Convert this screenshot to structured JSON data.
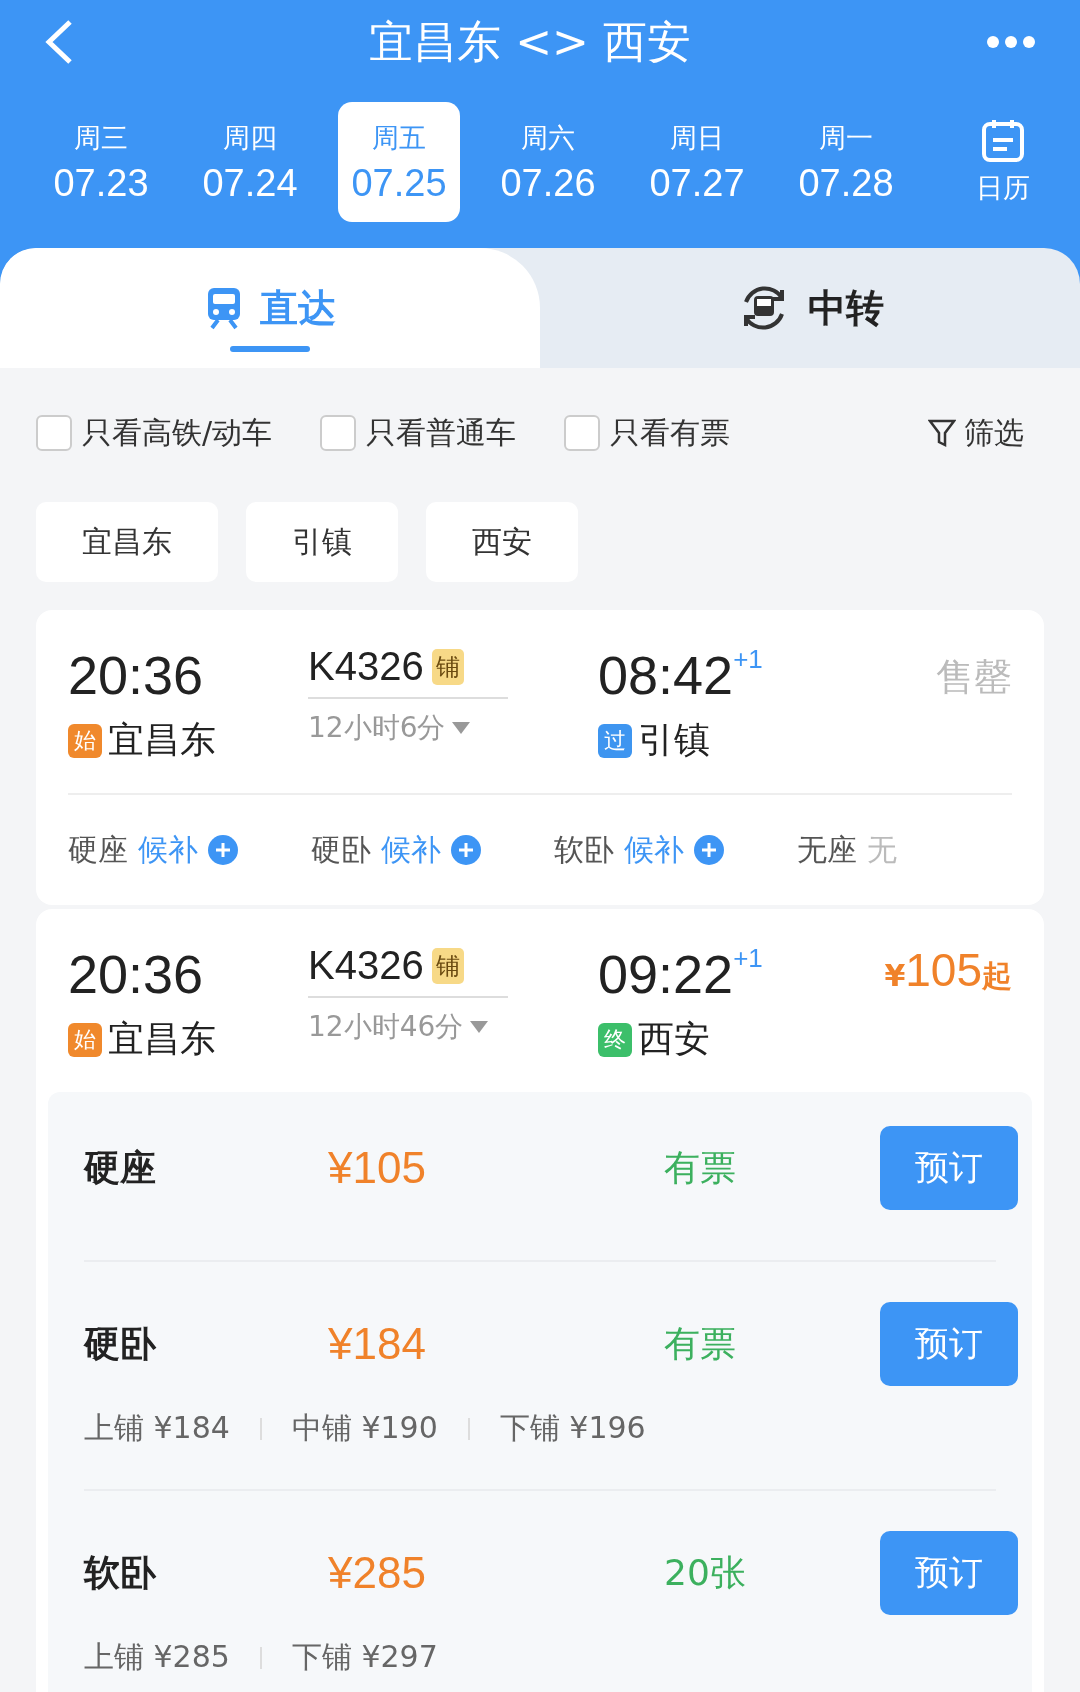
{
  "header": {
    "title": "宜昌东 <> 西安"
  },
  "dates": [
    {
      "weekday": "周三",
      "date": "07.23",
      "selected": false
    },
    {
      "weekday": "周四",
      "date": "07.24",
      "selected": false
    },
    {
      "weekday": "周五",
      "date": "07.25",
      "selected": true
    },
    {
      "weekday": "周六",
      "date": "07.26",
      "selected": false
    },
    {
      "weekday": "周日",
      "date": "07.27",
      "selected": false
    },
    {
      "weekday": "周一",
      "date": "07.28",
      "selected": false
    }
  ],
  "calendar": {
    "label": "日历"
  },
  "tabs": [
    {
      "label": "直达",
      "kind": "direct",
      "selected": true
    },
    {
      "label": "中转",
      "kind": "transfer",
      "selected": false
    }
  ],
  "filters": [
    {
      "label": "只看高铁/动车",
      "checked": false
    },
    {
      "label": "只看普通车",
      "checked": false
    },
    {
      "label": "只看有票",
      "checked": false
    }
  ],
  "filter_button": {
    "label": "筛选"
  },
  "stations": [
    "宜昌东",
    "引镇",
    "西安"
  ],
  "trains": [
    {
      "kind": "sold_out",
      "depart_time": "20:36",
      "depart_tag": {
        "label": "始",
        "color": "#f0892c"
      },
      "depart_station": "宜昌东",
      "number": "K4326",
      "badge": "铺",
      "duration": "12小时6分",
      "arrive_time": "08:42",
      "day_offset": "+1",
      "arrive_tag": {
        "label": "过",
        "color": "#3e95f0"
      },
      "arrive_station": "引镇",
      "status": "售罄",
      "seats": [
        {
          "seat": "硬座",
          "status": "候补",
          "waitlist": true
        },
        {
          "seat": "硬卧",
          "status": "候补",
          "waitlist": true
        },
        {
          "seat": "软卧",
          "status": "候补",
          "waitlist": true
        },
        {
          "seat": "无座",
          "status": "无",
          "waitlist": false
        }
      ]
    },
    {
      "kind": "available",
      "depart_time": "20:36",
      "depart_tag": {
        "label": "始",
        "color": "#f0892c"
      },
      "depart_station": "宜昌东",
      "number": "K4326",
      "badge": "铺",
      "duration": "12小时46分",
      "arrive_time": "09:22",
      "day_offset": "+1",
      "arrive_tag": {
        "label": "终",
        "color": "#3cbf6a"
      },
      "arrive_station": "西安",
      "price": {
        "symbol": "¥",
        "amount": "105",
        "suffix": "起"
      },
      "classes": [
        {
          "seat": "硬座",
          "price": "¥105",
          "availability": "有票",
          "button": "预订"
        },
        {
          "seat": "硬卧",
          "price": "¥184",
          "availability": "有票",
          "button": "预订",
          "berths": [
            "上铺 ¥184",
            "中铺 ¥190",
            "下铺 ¥196"
          ]
        },
        {
          "seat": "软卧",
          "price": "¥285",
          "availability": "20张",
          "button": "预订",
          "berths": [
            "上铺 ¥285",
            "下铺 ¥297"
          ]
        }
      ]
    }
  ]
}
